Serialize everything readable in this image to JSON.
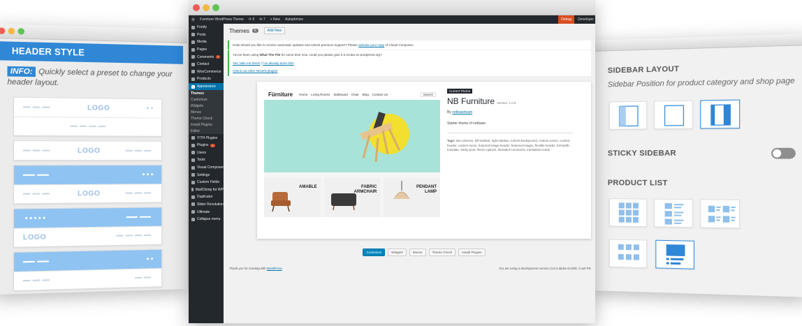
{
  "left_panel": {
    "title": "HEADER STYLE",
    "info_badge": "INFO:",
    "info_text": "Quickly select a preset to change your header layout.",
    "logo_text": "LOGO",
    "accent_color": "#2f87d6"
  },
  "right_panel": {
    "sidebar_layout_title": "SIDEBAR LAYOUT",
    "sidebar_layout_sub": "Sidebar Position for product category and shop page",
    "sticky_sidebar_title": "STICKY SIDEBAR",
    "sticky_sidebar_on": false,
    "product_list_title": "PRODUCT LIST"
  },
  "wp": {
    "adminbar": {
      "site": "Furniture WordPress Theme",
      "updates": "6",
      "comments": "7",
      "new": "New",
      "autoptimize": "Autoptimize",
      "debug": "Debug",
      "dev": "Developer"
    },
    "menu": [
      {
        "label": "Foody",
        "icon": "wp-logo-icon"
      },
      {
        "label": "Posts",
        "icon": "pin-icon"
      },
      {
        "label": "Media",
        "icon": "media-icon"
      },
      {
        "label": "Pages",
        "icon": "page-icon"
      },
      {
        "label": "Comments",
        "icon": "comment-icon",
        "count": "7"
      },
      {
        "label": "Contact",
        "icon": "mail-icon"
      },
      {
        "label": "WooCommerce",
        "icon": "cart-icon"
      },
      {
        "label": "Products",
        "icon": "box-icon"
      },
      {
        "label": "Appearance",
        "icon": "brush-icon",
        "active": true
      }
    ],
    "submenu": [
      "Themes",
      "Customize",
      "Widgets",
      "Menus",
      "Theme Check",
      "Install Plugins",
      "Editor"
    ],
    "menu_bottom": [
      {
        "label": "YITH Plugins",
        "icon": "plugin-icon"
      },
      {
        "label": "Plugins",
        "icon": "plug-icon",
        "count": "1"
      },
      {
        "label": "Users",
        "icon": "user-icon"
      },
      {
        "label": "Tools",
        "icon": "wrench-icon"
      },
      {
        "label": "Visual Composer",
        "icon": "vc-icon"
      },
      {
        "label": "Settings",
        "icon": "settings-icon"
      },
      {
        "label": "Custom Fields",
        "icon": "fields-icon"
      },
      {
        "label": "MailChimp for WP",
        "icon": "mailchimp-icon"
      },
      {
        "label": "Duplicator",
        "icon": "duplicate-icon"
      },
      {
        "label": "Slider Revolution",
        "icon": "slider-icon"
      },
      {
        "label": "Ultimate",
        "icon": "ultimate-icon"
      },
      {
        "label": "Collapse menu",
        "icon": "collapse-icon"
      }
    ],
    "page_title": "Themes",
    "theme_count": "6",
    "add_new": "Add New",
    "notice1": {
      "text": "Hola! Would you like to receive automatic updates and unlock premium support? Please",
      "link": "activate your copy",
      "tail": "of Visual Composer."
    },
    "notice2": {
      "text_pre": "You've been using",
      "plugin": "What The File",
      "text_post": "for some time now, could you please give it a review at wordpress.org?",
      "link_yes": "Yes, take me there!",
      "link_done": "I've already done this!",
      "link_more": "Check out other Never5 plugins"
    },
    "theme": {
      "current_tag": "Current Theme",
      "name": "NB Furniture",
      "version": "Version: 1.0.0",
      "by_pre": "By",
      "author": "netbaseteam",
      "description": "Starter theme of netbase",
      "tags_label": "Tags:",
      "tags": "two-columns, left-sidebar, right-sidebar, custom-background, custom-colors, custom-header, custom-menu, featured-image-header, featured-images, flexible-header, full-width-template, sticky-post, theme-options, threaded-comments, translation-ready"
    },
    "preview": {
      "brand": "Fürniture",
      "nav": [
        "Home",
        "Living Rooms",
        "Sideboard",
        "Chair",
        "Blog",
        "Contact Us"
      ],
      "search_placeholder": "Search",
      "products": [
        {
          "line1": "AMABLE",
          "line2": ""
        },
        {
          "line1": "FABRIC",
          "line2": "ARMCHAIR"
        },
        {
          "line1": "PENDANT",
          "line2": "LAMP"
        }
      ]
    },
    "actions": [
      "Customize",
      "Widgets",
      "Menus",
      "Theme Check",
      "Install Plugins"
    ],
    "footer_left_pre": "Thank you for creating with",
    "footer_left_link": "WordPress",
    "footer_right": "You are using a development version (4.8.2-alpha-41336). Cool! Ple"
  }
}
